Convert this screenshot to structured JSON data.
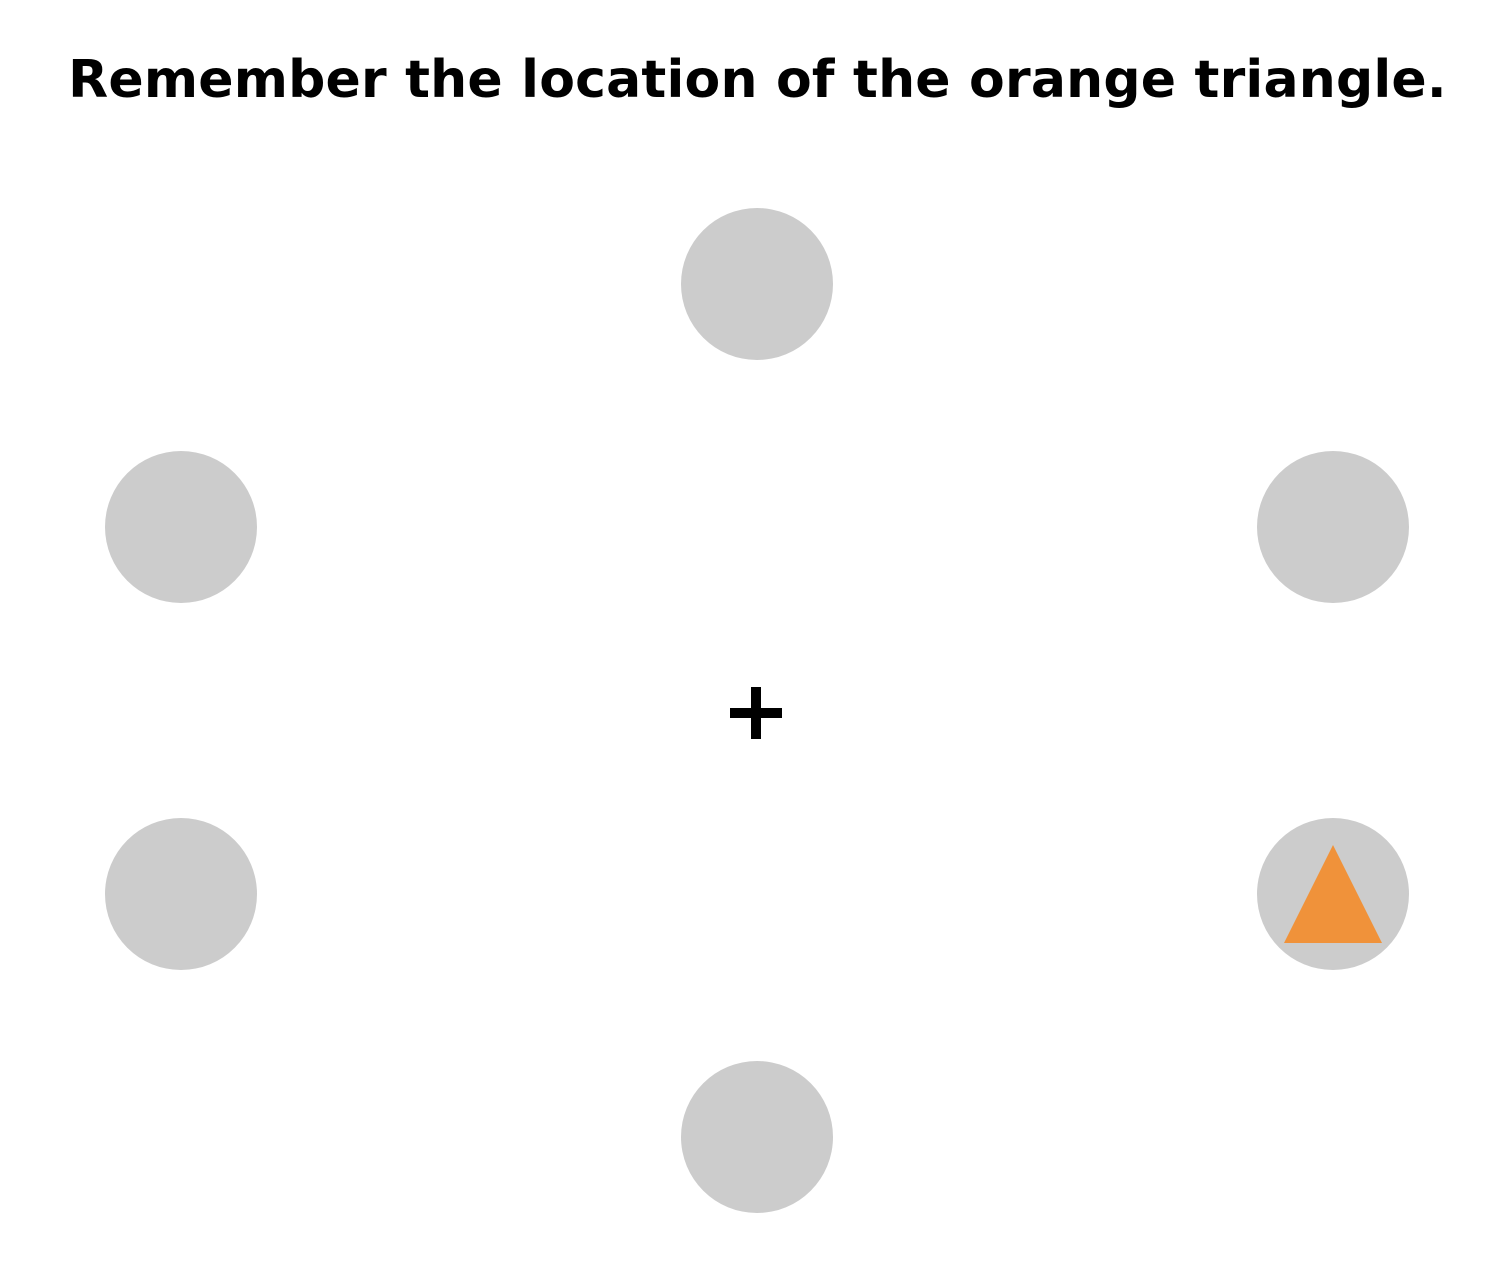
{
  "instruction": "Remember the location of the orange triangle.",
  "fixation_symbol": "+",
  "stimulus": {
    "shape": "triangle",
    "color": "#f0923a",
    "location": "lower-right"
  },
  "colors": {
    "background": "#ffffff",
    "placeholder": "#cccccc",
    "text": "#000000"
  },
  "placeholders": [
    {
      "id": "top",
      "content": "empty"
    },
    {
      "id": "upper-left",
      "content": "empty"
    },
    {
      "id": "upper-right",
      "content": "empty"
    },
    {
      "id": "lower-left",
      "content": "empty"
    },
    {
      "id": "lower-right",
      "content": "orange-triangle"
    },
    {
      "id": "bottom",
      "content": "empty"
    }
  ]
}
